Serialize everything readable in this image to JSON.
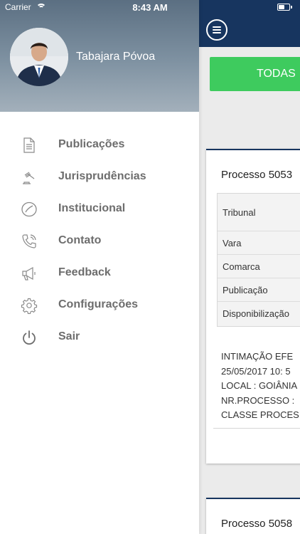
{
  "status_bar": {
    "carrier": "Carrier",
    "time": "8:43 AM"
  },
  "profile": {
    "name": "Tabajara Póvoa"
  },
  "menu": {
    "items": [
      {
        "label": "Publicações",
        "icon": "document-icon"
      },
      {
        "label": "Jurisprudências",
        "icon": "gavel-icon"
      },
      {
        "label": "Institucional",
        "icon": "institutional-icon"
      },
      {
        "label": "Contato",
        "icon": "phone-icon"
      },
      {
        "label": "Feedback",
        "icon": "megaphone-icon"
      },
      {
        "label": "Configurações",
        "icon": "gear-icon"
      },
      {
        "label": "Sair",
        "icon": "power-icon"
      }
    ]
  },
  "background_app": {
    "tab_label": "TODAS",
    "cards": [
      {
        "title": "Processo 5053",
        "rows": [
          "Tribunal",
          "Vara",
          "Comarca",
          "Publicação",
          "Disponibilização"
        ],
        "body_lines": [
          "INTIMAÇÃO EFE",
          "25/05/2017 10: 5",
          "LOCAL : GOIÂNIA",
          "NR.PROCESSO :",
          "CLASSE PROCES"
        ]
      },
      {
        "title": "Processo 5058"
      }
    ]
  },
  "colors": {
    "navbar": "#17355f",
    "tab_active": "#3ecb5e",
    "menu_text": "#6d6d6d",
    "menu_icon": "#8a8a8a"
  }
}
